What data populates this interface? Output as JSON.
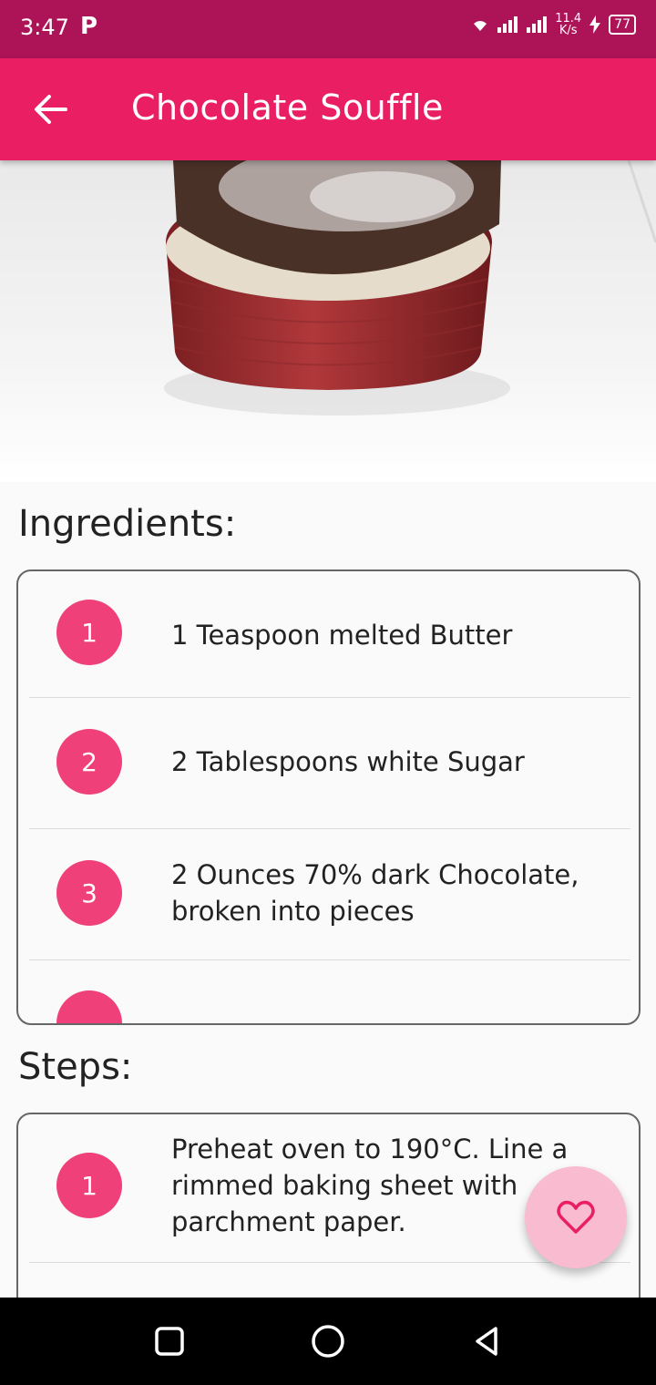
{
  "status_bar": {
    "time": "3:47",
    "app_badge": "P",
    "speed_value": "11.4",
    "speed_unit": "K/s",
    "battery": "77"
  },
  "app_bar": {
    "title": "Chocolate Souffle",
    "back_icon": "arrow-back-icon"
  },
  "ingredients": {
    "heading": "Ingredients:",
    "items": [
      {
        "number": "1",
        "text": "1 Teaspoon melted Butter"
      },
      {
        "number": "2",
        "text": "2 Tablespoons white Sugar"
      },
      {
        "number": "3",
        "text": "2 Ounces 70% dark Chocolate, broken into pieces"
      }
    ]
  },
  "steps": {
    "heading": "Steps:",
    "items": [
      {
        "number": "1",
        "text": "Preheat oven to 190°C. Line a rimmed baking sheet with parchment paper."
      }
    ]
  },
  "fab": {
    "icon": "heart-outline-icon"
  },
  "colors": {
    "status_bar": "#ad1457",
    "primary": "#e91e63",
    "badge": "#f0407a",
    "fab": "#f8bbd0"
  }
}
